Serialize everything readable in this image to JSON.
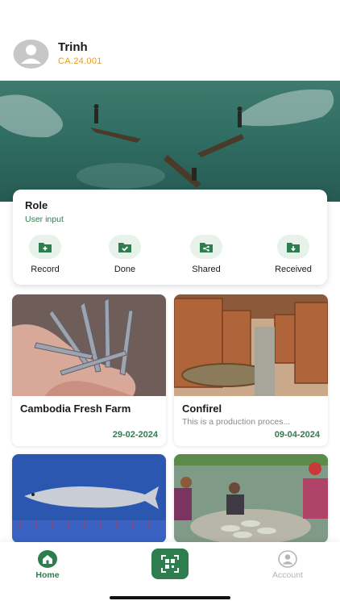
{
  "user": {
    "name": "Trinh",
    "code": "CA.24.001"
  },
  "role_card": {
    "title": "Role",
    "subtitle": "User input",
    "actions": [
      {
        "label": "Record",
        "icon": "folder-add-icon"
      },
      {
        "label": "Done",
        "icon": "folder-check-icon"
      },
      {
        "label": "Shared",
        "icon": "folder-share-icon"
      },
      {
        "label": "Received",
        "icon": "folder-download-icon"
      }
    ]
  },
  "products": [
    {
      "name": "Cambodia Fresh Farm",
      "description": "",
      "date": "29-02-2024"
    },
    {
      "name": "Confirel",
      "description": "This is a production proces...",
      "date": "09-04-2024"
    },
    {
      "name": "",
      "description": "",
      "date": ""
    },
    {
      "name": "",
      "description": "",
      "date": ""
    }
  ],
  "nav": {
    "home_label": "Home",
    "account_label": "Account",
    "active": "Home"
  },
  "colors": {
    "primary": "#2e7d4f",
    "accent_code": "#e3a024",
    "icon_bg": "#e7f2ea",
    "inactive": "#b5b5b5"
  }
}
